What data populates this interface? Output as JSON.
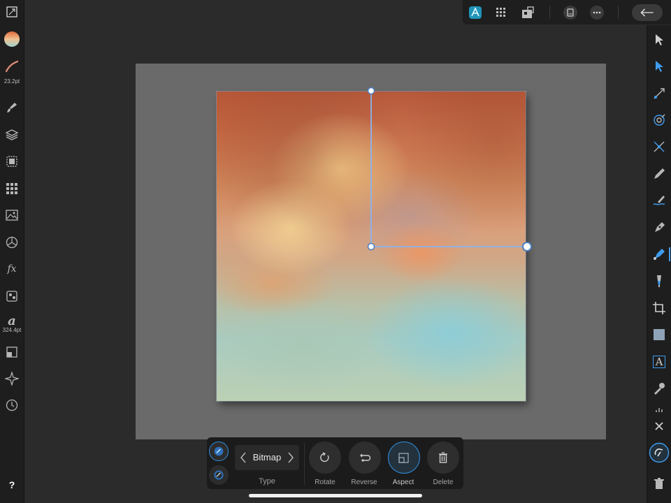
{
  "left_toolbar": {
    "brush_size": "23.2pt",
    "text_size": "324.4pt",
    "help": "?",
    "text_glyph": "a",
    "fx_glyph": "fx"
  },
  "right_toolbar": {
    "tools": [
      "move-tool",
      "node-tool",
      "corner-tool",
      "point-transform-tool",
      "fill-tool",
      "pencil-tool",
      "vector-brush-tool",
      "pen-tool",
      "gradient-tool",
      "transparency-tool",
      "vector-crop-tool",
      "rectangle-tool",
      "artistic-text-tool",
      "color-picker-tool"
    ],
    "active_tool": "gradient-tool",
    "text_tool_glyph": "A"
  },
  "context_toolbar": {
    "type_label": "Type",
    "type_value": "Bitmap",
    "buttons": [
      {
        "label": "Rotate",
        "icon": "rotate-icon"
      },
      {
        "label": "Reverse",
        "icon": "reverse-icon"
      },
      {
        "label": "Aspect",
        "icon": "aspect-icon",
        "active": true
      },
      {
        "label": "Delete",
        "icon": "trash-icon"
      }
    ]
  },
  "colors": {
    "accent": "#2f8fe0",
    "handle": "#8ab4f0",
    "app_icon": "#28c4e6"
  }
}
